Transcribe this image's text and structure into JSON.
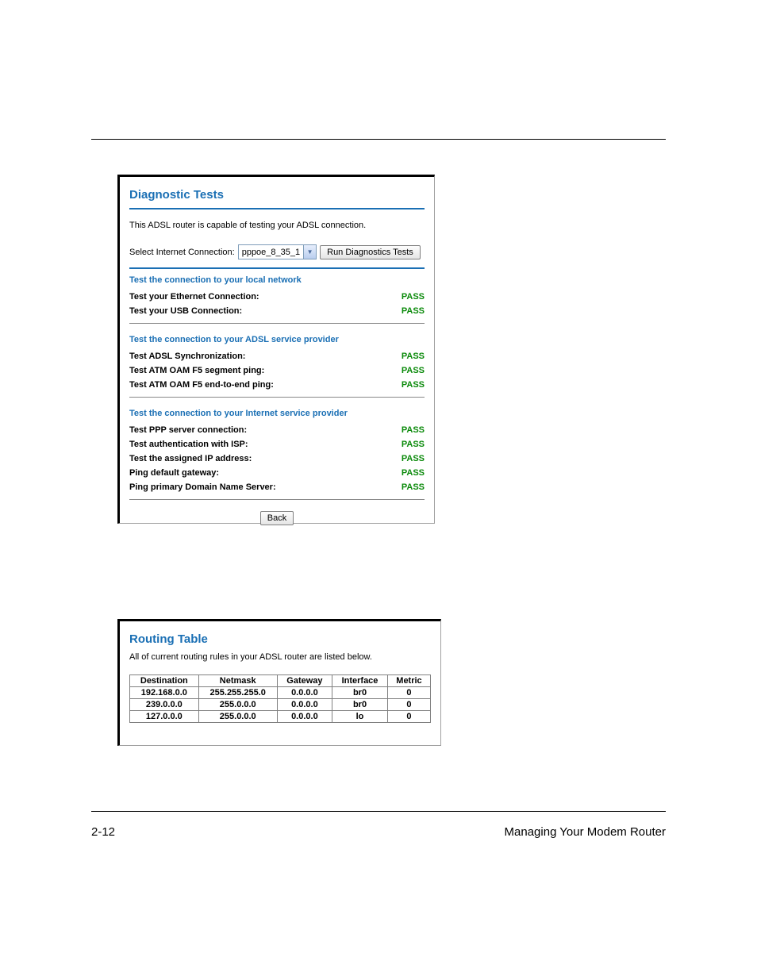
{
  "footer": {
    "page_num": "2-12",
    "section_title": "Managing Your Modem Router"
  },
  "diagnostics": {
    "title": "Diagnostic Tests",
    "intro": "This ADSL router is capable of testing your ADSL connection.",
    "select_label": "Select Internet Connection:",
    "select_value": "pppoe_8_35_1",
    "run_button": "Run Diagnostics Tests",
    "sections": [
      {
        "heading": "Test the connection to your local network",
        "tests": [
          {
            "label": "Test your Ethernet Connection:",
            "status": "PASS"
          },
          {
            "label": "Test your USB Connection:",
            "status": "PASS"
          }
        ]
      },
      {
        "heading": "Test the connection to your ADSL service provider",
        "tests": [
          {
            "label": "Test ADSL Synchronization:",
            "status": "PASS"
          },
          {
            "label": "Test ATM OAM F5 segment ping:",
            "status": "PASS"
          },
          {
            "label": "Test ATM OAM F5 end-to-end ping:",
            "status": "PASS"
          }
        ]
      },
      {
        "heading": "Test the connection to your Internet service provider",
        "tests": [
          {
            "label": "Test PPP server connection:",
            "status": "PASS"
          },
          {
            "label": "Test authentication with ISP:",
            "status": "PASS"
          },
          {
            "label": "Test the assigned IP address:",
            "status": "PASS"
          },
          {
            "label": "Ping default gateway:",
            "status": "PASS"
          },
          {
            "label": "Ping primary Domain Name Server:",
            "status": "PASS"
          }
        ]
      }
    ],
    "back_button": "Back"
  },
  "routing": {
    "title": "Routing Table",
    "intro": "All of current routing rules in your ADSL router are listed below.",
    "headers": [
      "Destination",
      "Netmask",
      "Gateway",
      "Interface",
      "Metric"
    ],
    "rows": [
      {
        "Destination": "192.168.0.0",
        "Netmask": "255.255.255.0",
        "Gateway": "0.0.0.0",
        "Interface": "br0",
        "Metric": "0"
      },
      {
        "Destination": "239.0.0.0",
        "Netmask": "255.0.0.0",
        "Gateway": "0.0.0.0",
        "Interface": "br0",
        "Metric": "0"
      },
      {
        "Destination": "127.0.0.0",
        "Netmask": "255.0.0.0",
        "Gateway": "0.0.0.0",
        "Interface": "lo",
        "Metric": "0"
      }
    ]
  }
}
